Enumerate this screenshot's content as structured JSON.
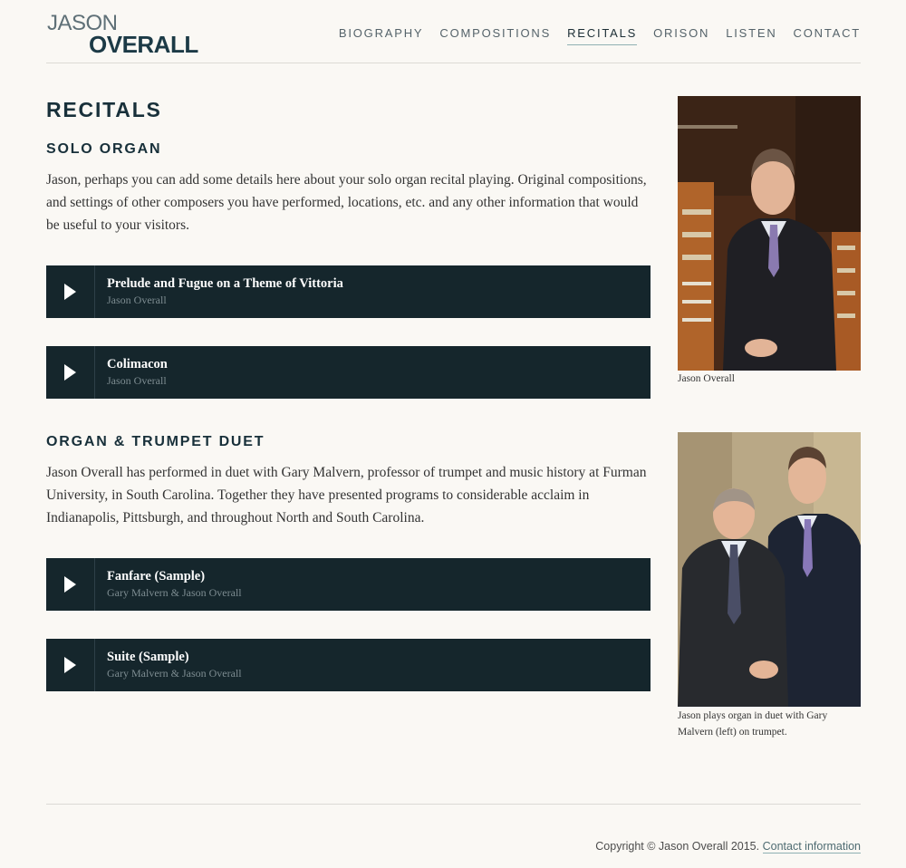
{
  "site": {
    "logo_line1": "JASON",
    "logo_line2": "OVERALL"
  },
  "nav": {
    "items": [
      {
        "label": "BIOGRAPHY"
      },
      {
        "label": "COMPOSITIONS"
      },
      {
        "label": "RECITALS",
        "active": true
      },
      {
        "label": "ORISON"
      },
      {
        "label": "LISTEN"
      },
      {
        "label": "CONTACT"
      }
    ]
  },
  "page": {
    "title": "RECITALS",
    "sections": [
      {
        "heading": "SOLO ORGAN",
        "text": "Jason, perhaps you can add some details here about your solo organ recital playing. Original compositions, and settings of other composers you have performed, locations, etc. and any other information that would be useful to your visitors.",
        "tracks": [
          {
            "title": "Prelude and Fugue on a Theme of Vittoria",
            "artist": "Jason Overall"
          },
          {
            "title": "Colimacon",
            "artist": "Jason Overall"
          }
        ]
      },
      {
        "heading": "ORGAN & TRUMPET DUET",
        "text": "Jason Overall has performed in duet with Gary Malvern, professor of trumpet and music history at Furman University, in South Carolina. Together they have presented programs to considerable acclaim in Indianapolis, Pittsburgh, and throughout North and South Carolina.",
        "tracks": [
          {
            "title": "Fanfare (Sample)",
            "artist": "Gary Malvern & Jason Overall"
          },
          {
            "title": "Suite (Sample)",
            "artist": "Gary Malvern & Jason Overall"
          }
        ]
      }
    ]
  },
  "sidebar": {
    "photos": [
      {
        "caption": "Jason Overall"
      },
      {
        "caption": "Jason plays organ in duet with Gary Malvern (left) on trumpet."
      }
    ]
  },
  "footer": {
    "copyright": "Copyright © Jason Overall 2015.",
    "link": "Contact information"
  },
  "colors": {
    "background": "#faf8f4",
    "heading": "#18303a",
    "player_bg": "#15262c",
    "accent_underline": "#8fb0b3"
  }
}
